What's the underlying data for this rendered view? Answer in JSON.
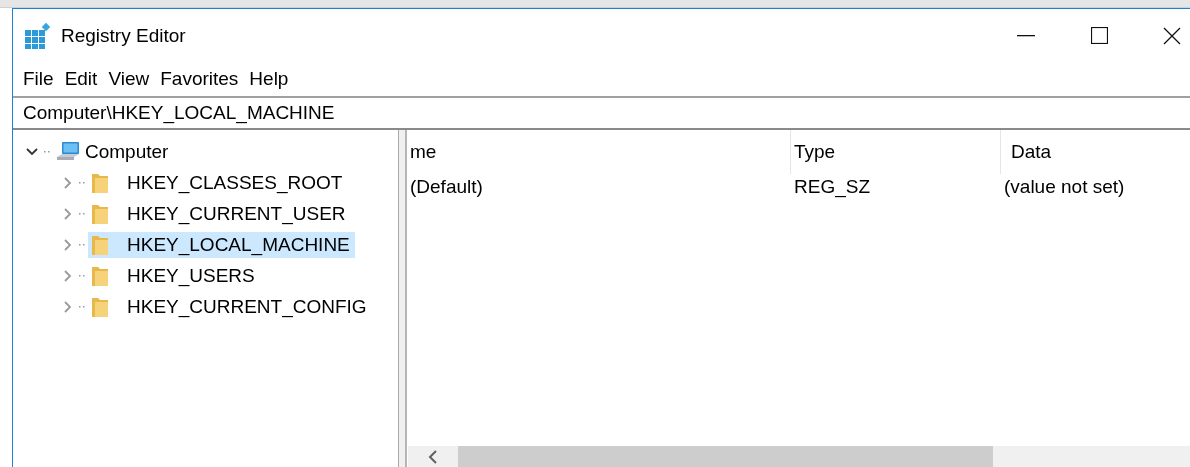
{
  "window": {
    "title": "Registry Editor"
  },
  "menu": [
    "File",
    "Edit",
    "View",
    "Favorites",
    "Help"
  ],
  "address": "Computer\\HKEY_LOCAL_MACHINE",
  "tree": {
    "label": "Computer",
    "expanded": true,
    "selected": false,
    "children": [
      {
        "label": "HKEY_CLASSES_ROOT",
        "expanded": false,
        "selected": false
      },
      {
        "label": "HKEY_CURRENT_USER",
        "expanded": false,
        "selected": false
      },
      {
        "label": "HKEY_LOCAL_MACHINE",
        "expanded": false,
        "selected": true
      },
      {
        "label": "HKEY_USERS",
        "expanded": false,
        "selected": false
      },
      {
        "label": "HKEY_CURRENT_CONFIG",
        "expanded": false,
        "selected": false
      }
    ]
  },
  "list": {
    "columns": [
      "me",
      "Type",
      "Data"
    ],
    "rows": [
      [
        "(Default)",
        "REG_SZ",
        "(value not set)"
      ]
    ]
  }
}
